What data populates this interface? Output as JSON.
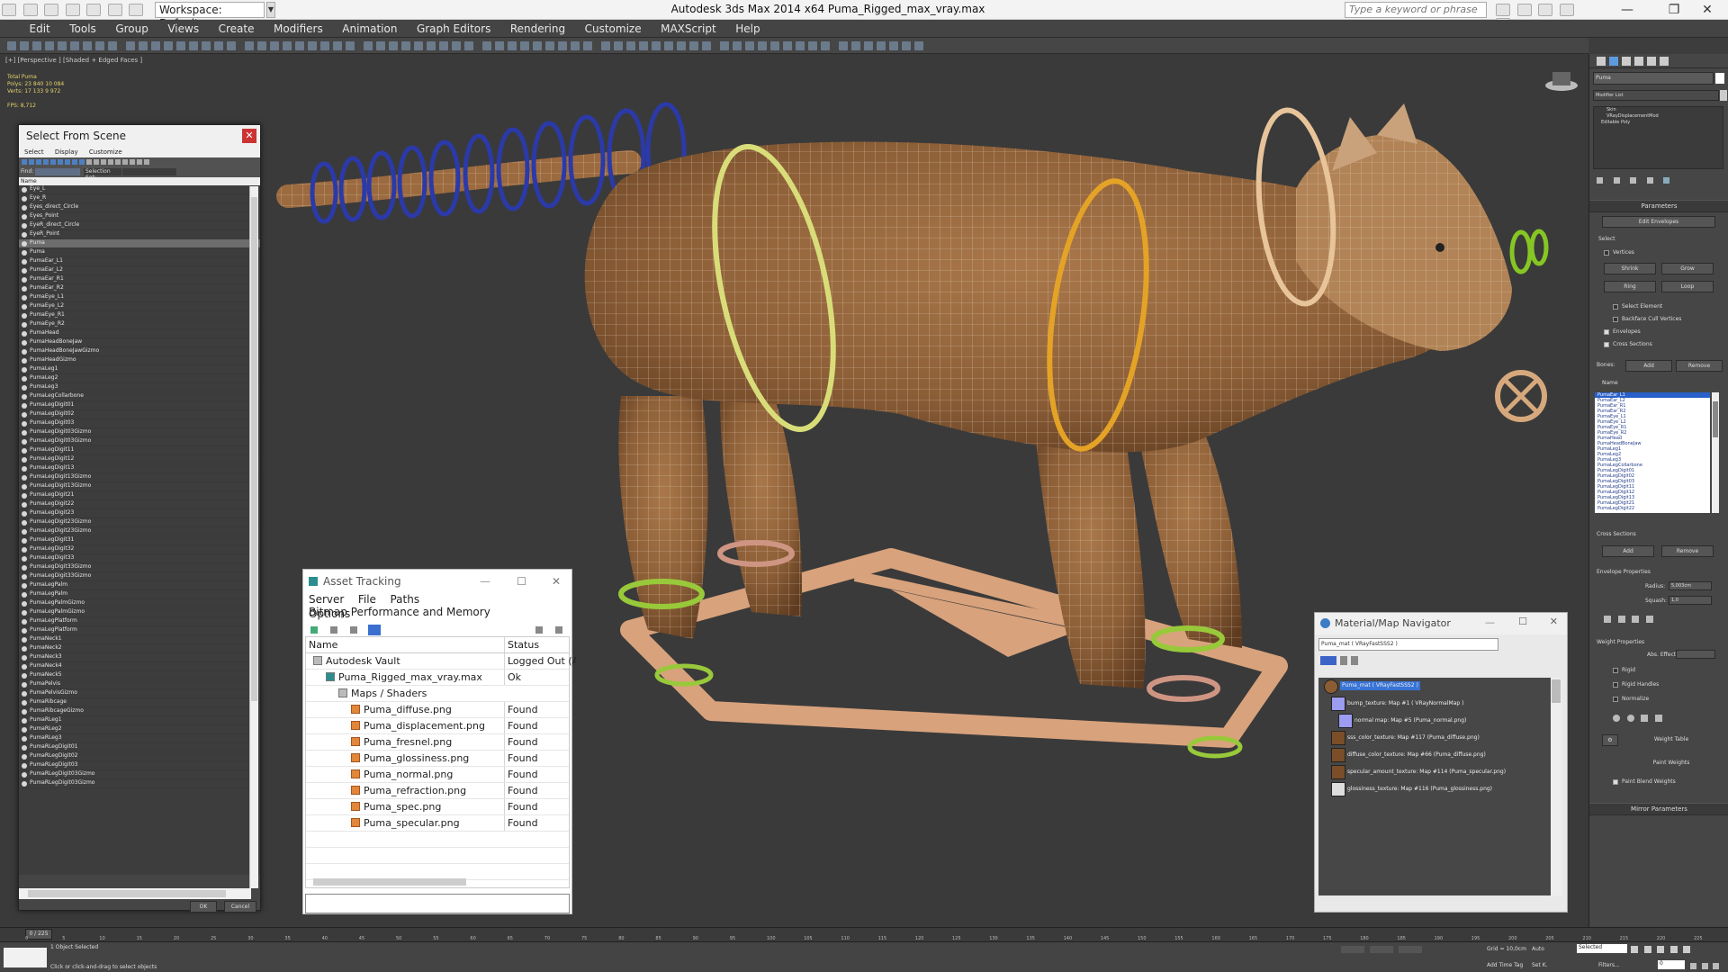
{
  "titlebar": {
    "workspace": "Workspace: Default",
    "title": "Autodesk 3ds Max  2014 x64     Puma_Rigged_max_vray.max",
    "search_placeholder": "Type a keyword or phrase"
  },
  "menu": [
    "Edit",
    "Tools",
    "Group",
    "Views",
    "Create",
    "Modifiers",
    "Animation",
    "Graph Editors",
    "Rendering",
    "Customize",
    "MAXScript",
    "Help"
  ],
  "viewport": {
    "label": "[+] [Perspective ] [Shaded + Edged Faces ]",
    "stats": {
      "head": "Total    Puma",
      "polys": "Polys:  23 840    10 084",
      "verts": "Verts:  17 133    9 972",
      "fps": "FPS:    8,712"
    }
  },
  "select_from_scene": {
    "title": "Select From Scene",
    "menus": [
      "Select",
      "Display",
      "Customize"
    ],
    "find_label": "Find:",
    "selection_set": "Selection Set:",
    "column": "Name",
    "ok": "OK",
    "cancel": "Cancel",
    "items": [
      "Eye_L",
      "Eye_R",
      "Eyes_direct_Circle",
      "Eyes_Point",
      "EyeR_direct_Circle",
      "EyeR_Point",
      "Puma",
      "Puma",
      "PumaEar_L1",
      "PumaEar_L2",
      "PumaEar_R1",
      "PumaEar_R2",
      "PumaEye_L1",
      "PumaEye_L2",
      "PumaEye_R1",
      "PumaEye_R2",
      "PumaHead",
      "PumaHeadBoneJaw",
      "PumaHeadBoneJawGizmo",
      "PumaHeadGizmo",
      "PumaLeg1",
      "PumaLeg2",
      "PumaLeg3",
      "PumaLegCollarbone",
      "PumaLegDigit01",
      "PumaLegDigit02",
      "PumaLegDigit03",
      "PumaLegDigit03Gizmo",
      "PumaLegDigit03Gizmo",
      "PumaLegDigit11",
      "PumaLegDigit12",
      "PumaLegDigit13",
      "PumaLegDigit13Gizmo",
      "PumaLegDigit13Gizmo",
      "PumaLegDigit21",
      "PumaLegDigit22",
      "PumaLegDigit23",
      "PumaLegDigit23Gizmo",
      "PumaLegDigit23Gizmo",
      "PumaLegDigit31",
      "PumaLegDigit32",
      "PumaLegDigit33",
      "PumaLegDigit33Gizmo",
      "PumaLegDigit33Gizmo",
      "PumaLegPalm",
      "PumaLegPalm",
      "PumaLegPalmGizmo",
      "PumaLegPalmGizmo",
      "PumaLegPlatform",
      "PumaLegPlatform",
      "PumaNeck1",
      "PumaNeck2",
      "PumaNeck3",
      "PumaNeck4",
      "PumaNeck5",
      "PumaPelvis",
      "PumaPelvisGizmo",
      "PumaRibcage",
      "PumaRibcageGizmo",
      "PumaRLeg1",
      "PumaRLeg2",
      "PumaRLeg3",
      "PumaRLegDigit01",
      "PumaRLegDigit02",
      "PumaRLegDigit03",
      "PumaRLegDigit03Gizmo",
      "PumaRLegDigit03Gizmo"
    ]
  },
  "asset_tracking": {
    "title": "Asset Tracking",
    "menus": [
      "Server",
      "File",
      "Paths",
      "Bitmap Performance and Memory"
    ],
    "menu2": "Options",
    "col_name": "Name",
    "col_status": "Status",
    "rows": [
      {
        "name": "Autodesk Vault",
        "status": "Logged Out (Ass",
        "indent": 0
      },
      {
        "name": "Puma_Rigged_max_vray.max",
        "status": "Ok",
        "indent": 1
      },
      {
        "name": "Maps / Shaders",
        "status": "",
        "indent": 2
      },
      {
        "name": "Puma_diffuse.png",
        "status": "Found",
        "indent": 3
      },
      {
        "name": "Puma_displacement.png",
        "status": "Found",
        "indent": 3
      },
      {
        "name": "Puma_fresnel.png",
        "status": "Found",
        "indent": 3
      },
      {
        "name": "Puma_glossiness.png",
        "status": "Found",
        "indent": 3
      },
      {
        "name": "Puma_normal.png",
        "status": "Found",
        "indent": 3
      },
      {
        "name": "Puma_refraction.png",
        "status": "Found",
        "indent": 3
      },
      {
        "name": "Puma_spec.png",
        "status": "Found",
        "indent": 3
      },
      {
        "name": "Puma_specular.png",
        "status": "Found",
        "indent": 3
      }
    ]
  },
  "material_navigator": {
    "title": "Material/Map Navigator",
    "field": "Puma_mat  ( VRayFastSSS2 )",
    "rows": [
      "Puma_mat  ( VRayFastSSS2 )",
      "bump_texture: Map #1  ( VRayNormalMap )",
      "normal map: Map #5 (Puma_normal.png)",
      "sss_color_texture: Map #117 (Puma_diffuse.png)",
      "diffuse_color_texture: Map #66 (Puma_diffuse.png)",
      "specular_amount_texture: Map #114 (Puma_specular.png)",
      "glossiness_texture: Map #116 (Puma_glossiness.png)"
    ]
  },
  "command_panel": {
    "object_name": "Puma",
    "modifier_list": "Modifier List",
    "stack": [
      "Skin",
      "VRayDisplacementMod",
      "Editable Poly"
    ],
    "parameters": "Parameters",
    "edit_envelopes": "Edit Envelopes",
    "select": "Select",
    "vertices": "Vertices",
    "shrink": "Shrink",
    "grow": "Grow",
    "ring": "Ring",
    "loop": "Loop",
    "select_element": "Select Element",
    "backface": "Backface Cull Vertices",
    "envelopes": "Envelopes",
    "cross_sections": "Cross Sections",
    "bones": "Bones:",
    "add": "Add",
    "remove": "Remove",
    "name": "Name",
    "bone_list": [
      "PumaEar_L1",
      "PumaEar_L2",
      "PumaEar_R1",
      "PumaEar_R2",
      "PumaEye_L1",
      "PumaEye_L2",
      "PumaEye_R1",
      "PumaEye_R2",
      "PumaHead",
      "PumaHeadBoneJaw",
      "PumaLeg1",
      "PumaLeg2",
      "PumaLeg3",
      "PumaLegCollarbone",
      "PumaLegDigit01",
      "PumaLegDigit02",
      "PumaLegDigit03",
      "PumaLegDigit11",
      "PumaLegDigit12",
      "PumaLegDigit13",
      "PumaLegDigit21",
      "PumaLegDigit22"
    ],
    "cross_sections_lbl": "Cross Sections",
    "envelope_props": "Envelope Properties",
    "radius": "Radius:",
    "radius_val": "5,003cm",
    "squash": "Squash:",
    "squash_val": "1,0",
    "weight_props": "Weight Properties",
    "abs_effect": "Abs. Effect:",
    "rigid": "Rigid",
    "rigid_handles": "Rigid Handles",
    "normalize": "Normalize",
    "weight_table": "Weight Table",
    "paint_weights": "Paint Weights",
    "paint_blend": "Paint Blend Weights",
    "mirror": "Mirror Parameters"
  },
  "timeline": {
    "frame": "0 / 225",
    "ticks": [
      "0",
      "5",
      "10",
      "15",
      "20",
      "25",
      "30",
      "35",
      "40",
      "45",
      "50",
      "55",
      "60",
      "65",
      "70",
      "75",
      "80",
      "85",
      "90",
      "95",
      "100",
      "105",
      "110",
      "115",
      "120",
      "125",
      "130",
      "135",
      "140",
      "145",
      "150",
      "155",
      "160",
      "165",
      "170",
      "175",
      "180",
      "185",
      "190",
      "195",
      "200",
      "205",
      "210",
      "215",
      "220",
      "225"
    ]
  },
  "status": {
    "selected": "1 Object Selected",
    "hint": "Click or click-and-drag to select objects",
    "grid": "Grid = 10,0cm",
    "auto": "Auto",
    "selected_dd": "Selected",
    "set_k": "Set K.",
    "filters": "Filters...",
    "add_time_tag": "Add Time Tag",
    "frame_val": "0"
  }
}
